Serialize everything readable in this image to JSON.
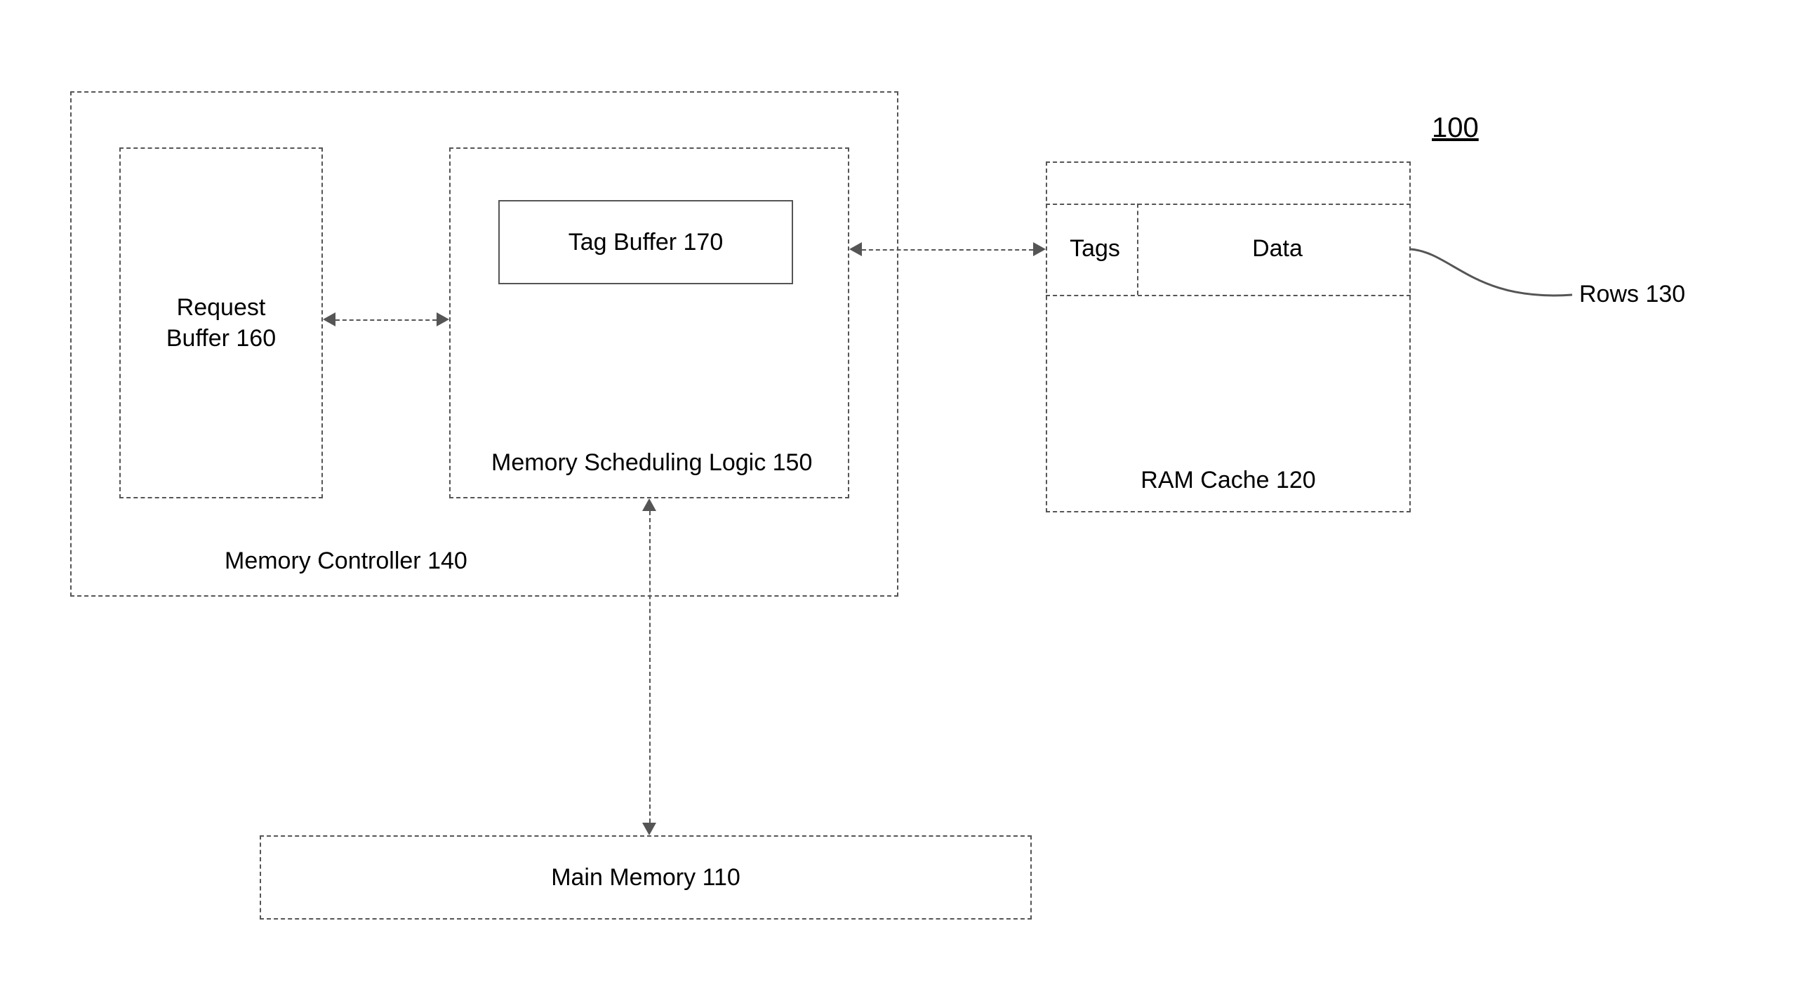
{
  "figure_number": "100",
  "memory_controller": {
    "label": "Memory Controller 140",
    "request_buffer": {
      "label": "Request Buffer 160"
    },
    "scheduling_logic": {
      "label": "Memory Scheduling Logic 150",
      "tag_buffer": {
        "label": "Tag Buffer 170"
      }
    }
  },
  "ram_cache": {
    "label": "RAM Cache 120",
    "tags_label": "Tags",
    "data_label": "Data",
    "rows_callout": "Rows 130"
  },
  "main_memory": {
    "label": "Main Memory 110"
  }
}
